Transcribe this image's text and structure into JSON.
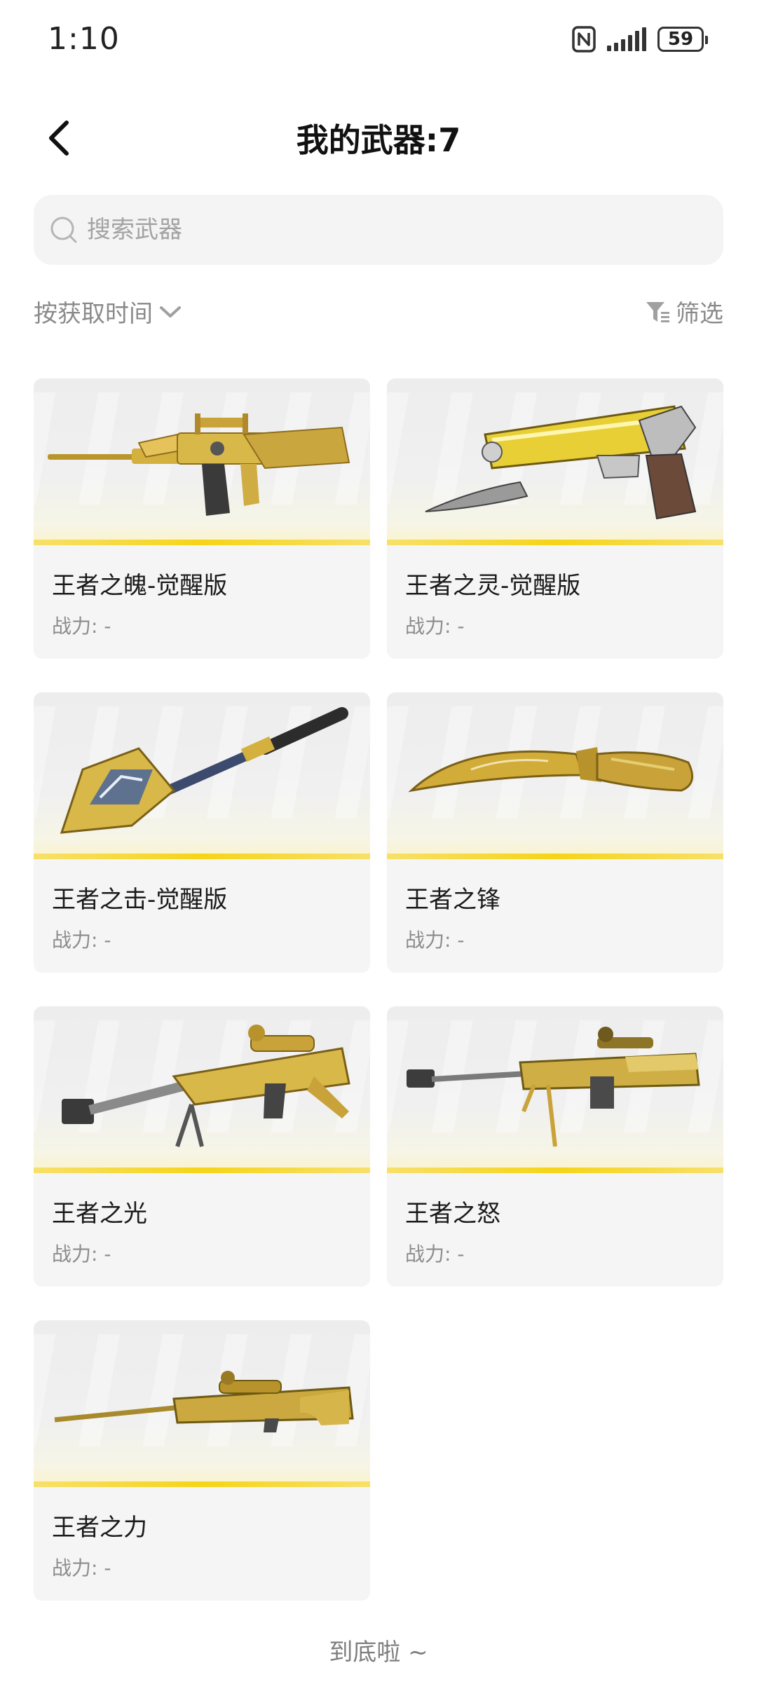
{
  "status_bar": {
    "time": "1:10",
    "battery": "59",
    "icons": [
      "nfc-icon",
      "signal-icon",
      "battery-icon"
    ]
  },
  "header": {
    "back_icon": "chevron-left-icon",
    "title": "我的武器:7"
  },
  "search": {
    "icon": "search-icon",
    "placeholder": "搜索武器",
    "value": ""
  },
  "filters": {
    "sort_label": "按获取时间",
    "sort_icon": "chevron-down-icon",
    "filter_label": "筛选",
    "filter_icon": "filter-icon"
  },
  "weapons": [
    {
      "name": "王者之魄-觉醒版",
      "power": "战力: -",
      "art": "gold-assault-rifle"
    },
    {
      "name": "王者之灵-觉醒版",
      "power": "战力: -",
      "art": "gold-pistol"
    },
    {
      "name": "王者之击-觉醒版",
      "power": "战力: -",
      "art": "gold-shovel"
    },
    {
      "name": "王者之锋",
      "power": "战力: -",
      "art": "gold-kukri-knife"
    },
    {
      "name": "王者之光",
      "power": "战力: -",
      "art": "gold-heavy-sniper"
    },
    {
      "name": "王者之怒",
      "power": "战力: -",
      "art": "gold-anti-materiel-rifle"
    },
    {
      "name": "王者之力",
      "power": "战力: -",
      "art": "gold-sniper-rifle"
    }
  ],
  "footer": {
    "end_text": "到底啦 ~"
  },
  "colors": {
    "accent_gold": "#d9b43a",
    "rarity_bar": "#f6d418",
    "card_bg": "#f5f5f5",
    "muted_text": "#8a8a8a"
  }
}
